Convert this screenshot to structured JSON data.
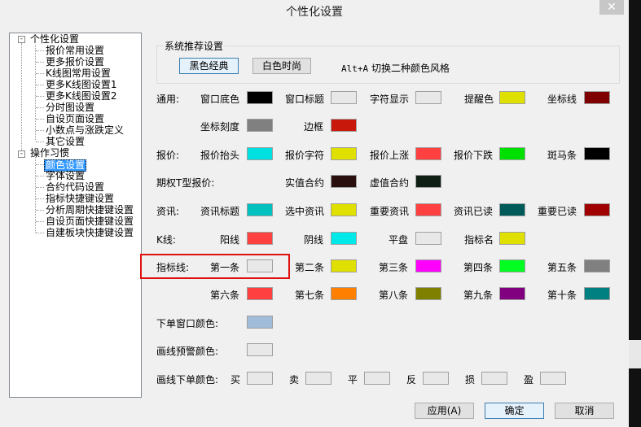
{
  "window": {
    "title": "个性化设置",
    "close_glyph": "✕"
  },
  "tree": {
    "groups": [
      {
        "label": "个性化设置",
        "expander": "-",
        "children": [
          "报价常用设置",
          "更多报价设置",
          "K线图常用设置",
          "更多K线图设置1",
          "更多K线图设置2",
          "分时图设置",
          "自设页面设置",
          "小数点与涨跌定义",
          "其它设置"
        ]
      },
      {
        "label": "操作习惯",
        "expander": "-",
        "children": [
          "颜色设置",
          "字体设置",
          "合约代码设置",
          "指标快捷键设置",
          "分析周期快捷键设置",
          "自设页面快捷键设置",
          "自建板块快捷键设置"
        ]
      }
    ],
    "selected": "颜色设置"
  },
  "recommend": {
    "group_label": "系统推荐设置",
    "btn_black": "黑色经典",
    "btn_white": "白色时尚",
    "hint_key": "Alt+A",
    "hint_text": " 切换二种颜色风格"
  },
  "colors": {
    "general": {
      "label": "通用:",
      "items": [
        {
          "label": "窗口底色",
          "color": "#000000"
        },
        {
          "label": "窗口标题",
          "color": "#e8e8e8"
        },
        {
          "label": "字符显示",
          "color": "#e8e8e8"
        },
        {
          "label": "提醒色",
          "color": "#e0e000"
        },
        {
          "label": "坐标线",
          "color": "#7f0000"
        },
        {
          "label": "坐标刻度",
          "color": "#808080"
        },
        {
          "label": "边框",
          "color": "#c8180c"
        }
      ]
    },
    "quote": {
      "label": "报价:",
      "items": [
        {
          "label": "报价抬头",
          "color": "#00e0e0"
        },
        {
          "label": "报价字符",
          "color": "#e0e000"
        },
        {
          "label": "报价上涨",
          "color": "#ff4040"
        },
        {
          "label": "报价下跌",
          "color": "#00e000"
        },
        {
          "label": "斑马条",
          "color": "#000000"
        }
      ]
    },
    "option": {
      "label": "期权T型报价:",
      "items": [
        {
          "label": "实值合约",
          "color": "#2a0f0f"
        },
        {
          "label": "虚值合约",
          "color": "#0f1f14"
        }
      ]
    },
    "news": {
      "label": "资讯:",
      "items": [
        {
          "label": "资讯标题",
          "color": "#00c0c0"
        },
        {
          "label": "选中资讯",
          "color": "#e0e000"
        },
        {
          "label": "重要资讯",
          "color": "#ff4040"
        },
        {
          "label": "资讯已读",
          "color": "#005a5a"
        },
        {
          "label": "重要已读",
          "color": "#a00000"
        }
      ]
    },
    "kline": {
      "label": "K线:",
      "items": [
        {
          "label": "阳线",
          "color": "#ff4040"
        },
        {
          "label": "阴线",
          "color": "#00e8e8"
        },
        {
          "label": "平盘",
          "color": "#e8e8e8"
        },
        {
          "label": "指标名",
          "color": "#e0e000"
        }
      ]
    },
    "indicator": {
      "label": "指标线:",
      "items": [
        {
          "label": "第一条",
          "color": "#e8e8e8"
        },
        {
          "label": "第二条",
          "color": "#e0e000"
        },
        {
          "label": "第三条",
          "color": "#ff00ff"
        },
        {
          "label": "第四条",
          "color": "#00ff20"
        },
        {
          "label": "第五条",
          "color": "#808080"
        },
        {
          "label": "第六条",
          "color": "#ff4040"
        },
        {
          "label": "第七条",
          "color": "#ff8000"
        },
        {
          "label": "第八条",
          "color": "#808000"
        },
        {
          "label": "第九条",
          "color": "#800080"
        },
        {
          "label": "第十条",
          "color": "#008080"
        }
      ]
    },
    "order_window": {
      "label": "下单窗口颜色:",
      "color": "#a0bcd8"
    },
    "warn_line": {
      "label": "画线预警颜色:",
      "color": "#e8e8e8"
    },
    "order_line": {
      "label": "画线下单颜色:",
      "items": [
        {
          "label": "买",
          "color": "#e8e8e8"
        },
        {
          "label": "卖",
          "color": "#e8e8e8"
        },
        {
          "label": "平",
          "color": "#e8e8e8"
        },
        {
          "label": "反",
          "color": "#e8e8e8"
        },
        {
          "label": "损",
          "color": "#e8e8e8"
        },
        {
          "label": "盈",
          "color": "#e8e8e8"
        }
      ]
    }
  },
  "footer": {
    "apply": "应用(A)",
    "ok": "确定",
    "cancel": "取消"
  }
}
